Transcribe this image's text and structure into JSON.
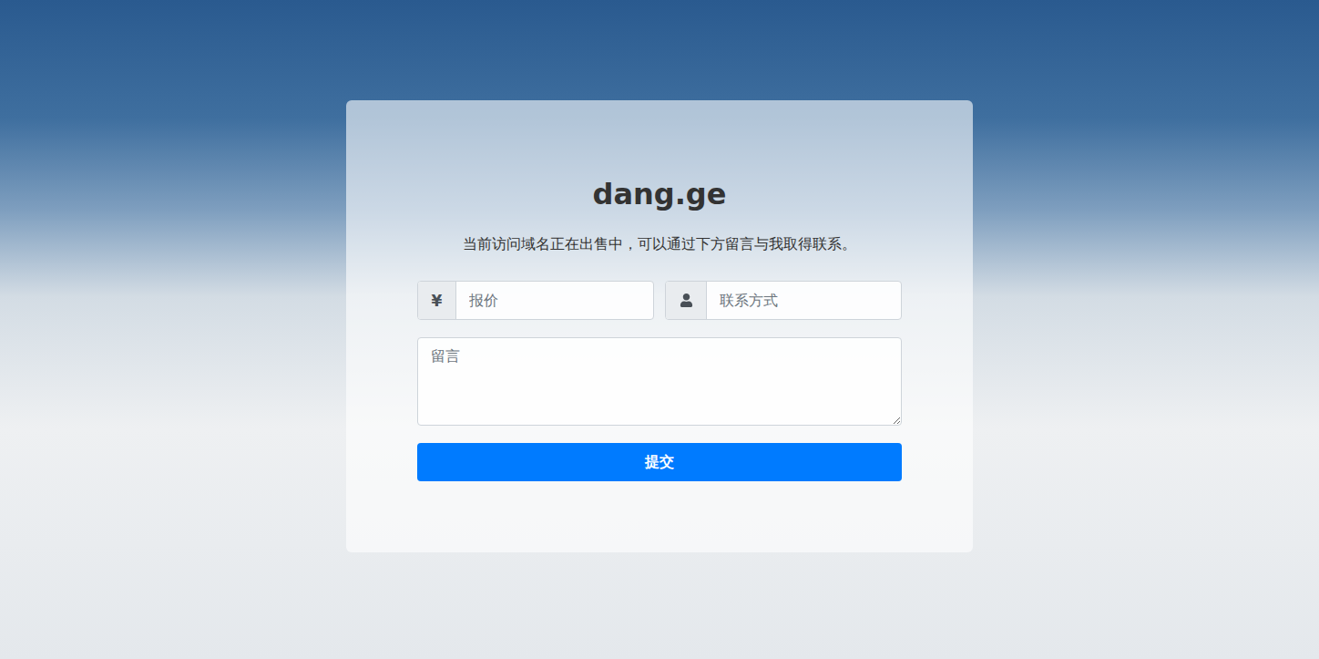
{
  "page": {
    "title": "dang.ge",
    "subtitle": "当前访问域名正在出售中，可以通过下方留言与我取得联系。"
  },
  "form": {
    "price": {
      "prefix": "¥",
      "placeholder": "报价"
    },
    "contact": {
      "placeholder": "联系方式"
    },
    "message": {
      "placeholder": "留言"
    },
    "submit": "提交"
  }
}
